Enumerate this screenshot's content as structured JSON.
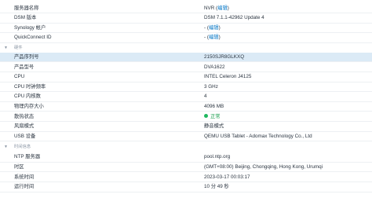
{
  "general": {
    "server_name": {
      "label": "服务器名称",
      "value": "NVR",
      "action": "编辑"
    },
    "dsm_version": {
      "label": "DSM 版本",
      "value": "DSM 7.1.1-42962 Update 4"
    },
    "synology_account": {
      "label": "Synology 帐户",
      "value": "-",
      "action": "编辑"
    },
    "quickconnect_id": {
      "label": "QuickConnect ID",
      "value": "-",
      "action": "编辑"
    }
  },
  "hardware": {
    "section_title": "硬件",
    "serial": {
      "label": "产品序列号",
      "value": "2150SJR8GLKXQ"
    },
    "model": {
      "label": "产品型号",
      "value": "DVA1622"
    },
    "cpu": {
      "label": "CPU",
      "value": "INTEL Celeron J4125"
    },
    "cpu_clock": {
      "label": "CPU 时钟频率",
      "value": "3 GHz"
    },
    "cpu_cores": {
      "label": "CPU 内核数",
      "value": "4"
    },
    "memory": {
      "label": "物理内存大小",
      "value": "4096 MB"
    },
    "thermal": {
      "label": "散热状态",
      "value": "正常",
      "status_color": "#1fb860"
    },
    "fan_mode": {
      "label": "风扇模式",
      "value": "静音模式"
    },
    "usb": {
      "label": "USB 设备",
      "value": "QEMU USB Tablet - Adomax Technology Co., Ltd"
    }
  },
  "time": {
    "section_title": "时间信息",
    "ntp": {
      "label": "NTP 服务器",
      "value": "pool.ntp.org"
    },
    "timezone": {
      "label": "时区",
      "value": "(GMT+08:00) Beijing, Chongqing, Hong Kong, Urumqi"
    },
    "system_time": {
      "label": "系统时间",
      "value": "2023-03-17 00:03:17"
    },
    "uptime": {
      "label": "运行时间",
      "value": "10 分 49 秒"
    }
  },
  "colors": {
    "accent": "#0a7ac8",
    "selected_row": "#dbeaf6",
    "section_text": "#8a96a4"
  }
}
